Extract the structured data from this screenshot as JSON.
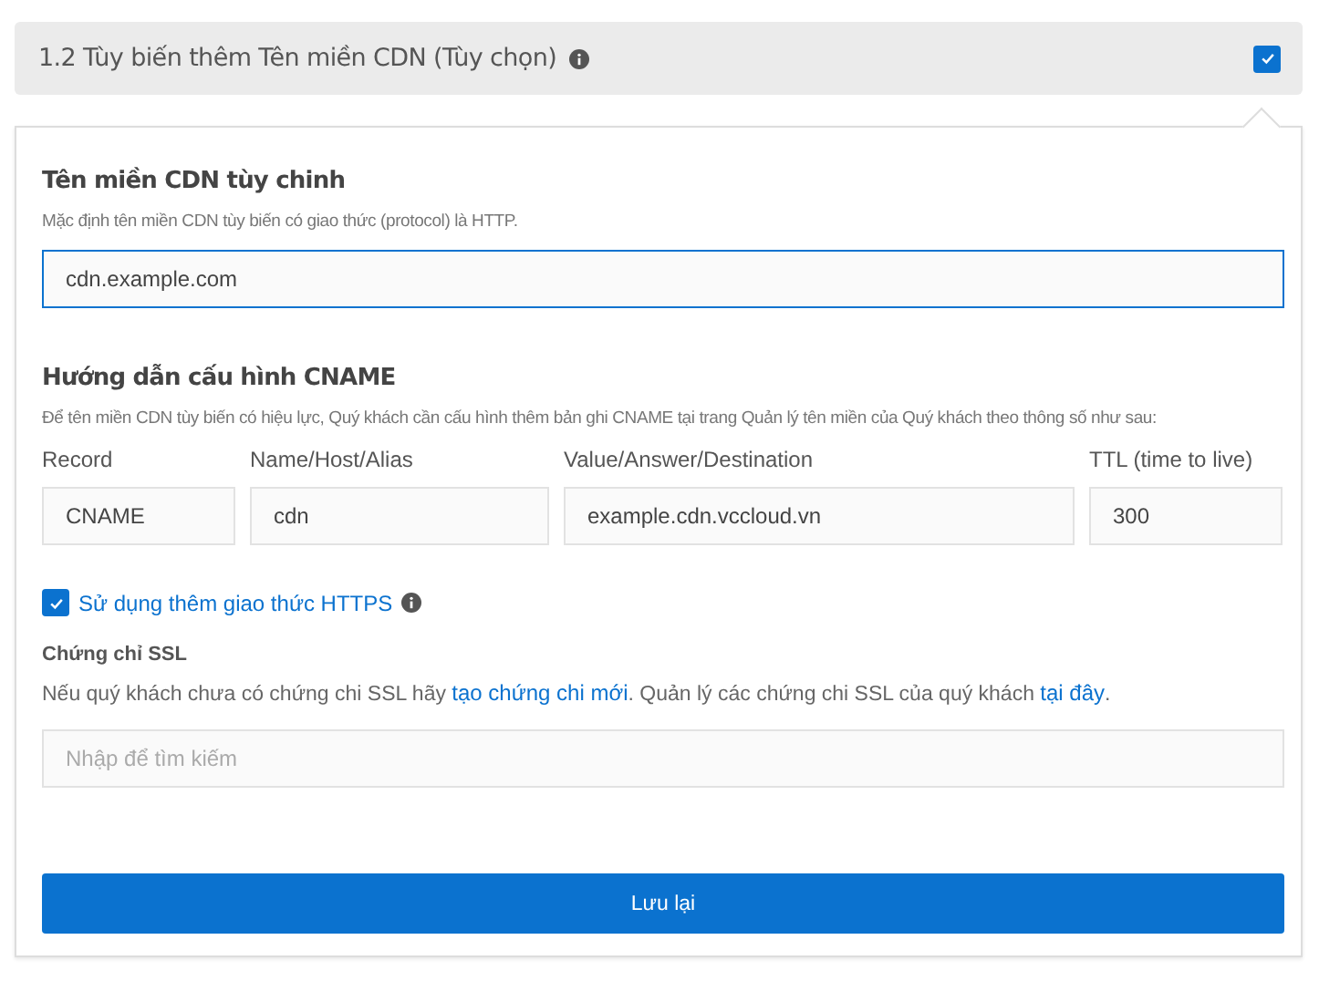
{
  "header": {
    "title": "1.2 Tùy biến thêm Tên miền CDN (Tùy chọn)",
    "checked": true
  },
  "custom_domain": {
    "title": "Tên miền CDN tùy chinh",
    "hint": "Mặc định tên miền CDN tùy biến có giao thức (protocol) là HTTP.",
    "value": "cdn.example.com"
  },
  "cname": {
    "title": "Hướng dẫn cấu hình CNAME",
    "hint": "Để tên miền CDN tùy biến có hiệu lực, Quý khách cần cấu hình thêm bản ghi CNAME tại trang Quản lý tên miền của Quý khách theo thông số như sau:",
    "columns": [
      {
        "label": "Record",
        "value": "CNAME"
      },
      {
        "label": "Name/Host/Alias",
        "value": "cdn"
      },
      {
        "label": "Value/Answer/Destination",
        "value": "example.cdn.vccloud.vn"
      },
      {
        "label": "TTL (time to live)",
        "value": "300"
      }
    ]
  },
  "https": {
    "label": "Sử dụng thêm giao thức HTTPS",
    "checked": true
  },
  "ssl": {
    "title": "Chứng chỉ SSL",
    "description": [
      {
        "kind": "text",
        "text": "Nếu quý khách chưa có chứng chi SSL hãy "
      },
      {
        "kind": "link",
        "text": "tạo chứng chi mới"
      },
      {
        "kind": "text",
        "text": ". Quản lý các chứng chi SSL của quý khách "
      },
      {
        "kind": "link",
        "text": "tại đây"
      },
      {
        "kind": "text",
        "text": "."
      }
    ],
    "placeholder": "Nhập để tìm kiếm"
  },
  "save_button": "Lưu lại"
}
